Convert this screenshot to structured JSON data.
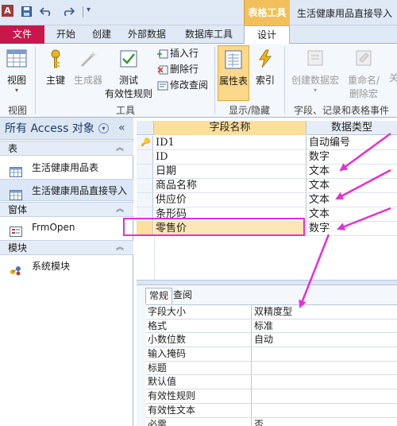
{
  "app_icon": "A",
  "window": {
    "title": "生活健康用品直接导入",
    "context_tab": "表格工具"
  },
  "quick_access": {
    "icons": [
      "save-icon",
      "undo-icon",
      "redo-icon",
      "customize-icon"
    ]
  },
  "ribbon_tabs": [
    "文件",
    "开始",
    "创建",
    "外部数据",
    "数据库工具",
    "设计"
  ],
  "ribbon": {
    "view": {
      "label": "视图",
      "group": "视图"
    },
    "tools": {
      "group": "工具",
      "primary_key": "主键",
      "builder": "生成器",
      "test_rules_1": "测试",
      "test_rules_2": "有效性规则",
      "insert_rows": "插入行",
      "delete_rows": "删除行",
      "modify_lookups": "修改查阅"
    },
    "show_hide": {
      "group": "显示/隐藏",
      "property_sheet": "属性表",
      "indexes": "索引"
    },
    "field_events": {
      "group": "字段、记录和表格事件",
      "create_macro": "创建数据宏",
      "rename_delete_1": "重命名/",
      "rename_delete_2": "删除宏",
      "cut_off": "关"
    }
  },
  "nav": {
    "title": "所有 Access 对象",
    "sections": [
      {
        "label": "表",
        "items": [
          "生活健康用品表",
          "生活健康用品直接导入"
        ]
      },
      {
        "label": "窗体",
        "items": [
          "FrmOpen"
        ]
      },
      {
        "label": "模块",
        "items": [
          "系统模块"
        ]
      }
    ]
  },
  "grid": {
    "headers": [
      "字段名称",
      "数据类型"
    ],
    "rows": [
      {
        "name": "ID1",
        "type": "自动编号"
      },
      {
        "name": "ID",
        "type": "数字"
      },
      {
        "name": "日期",
        "type": "文本"
      },
      {
        "name": "商品名称",
        "type": "文本"
      },
      {
        "name": "供应价",
        "type": "文本"
      },
      {
        "name": "条形码",
        "type": "文本"
      },
      {
        "name": "零售价",
        "type": "数字"
      }
    ]
  },
  "properties": {
    "tabs": [
      "常规",
      "查阅"
    ],
    "rows": [
      {
        "name": "字段大小",
        "value": "双精度型"
      },
      {
        "name": "格式",
        "value": "标准"
      },
      {
        "name": "小数位数",
        "value": "自动"
      },
      {
        "name": "输入掩码",
        "value": ""
      },
      {
        "name": "标题",
        "value": ""
      },
      {
        "name": "默认值",
        "value": ""
      },
      {
        "name": "有效性规则",
        "value": ""
      },
      {
        "name": "有效性文本",
        "value": ""
      },
      {
        "name": "必需",
        "value": "否"
      }
    ]
  },
  "colors": {
    "file_tab": "#c8174a",
    "context_tab": "#f2c05a",
    "annotation": "#e62fd6",
    "selected_button": "#fbd88a"
  }
}
